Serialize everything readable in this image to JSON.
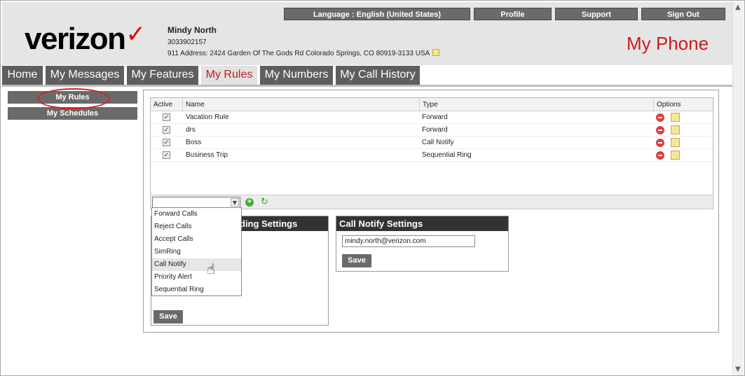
{
  "top_nav": {
    "language": "Language : English (United States)",
    "profile": "Profile",
    "support": "Support",
    "sign_out": "Sign Out"
  },
  "brand": {
    "logo_text": "verizon",
    "logo_mark": "✓",
    "page_heading": "My Phone"
  },
  "user": {
    "name": "Mindy North",
    "phone": "3033902157",
    "address": "911 Address: 2424 Garden Of The Gods Rd Colorado Springs, CO 80919-3133 USA"
  },
  "tabs": [
    {
      "label": "Home"
    },
    {
      "label": "My Messages"
    },
    {
      "label": "My Features"
    },
    {
      "label": "My Rules"
    },
    {
      "label": "My Numbers"
    },
    {
      "label": "My Call History"
    }
  ],
  "active_tab": "My Rules",
  "sidebar": {
    "items": [
      {
        "label": "My Rules"
      },
      {
        "label": "My Schedules"
      }
    ]
  },
  "rules_table": {
    "columns": [
      "Active",
      "Name",
      "Type",
      "Options"
    ],
    "rows": [
      {
        "active": true,
        "name": "Vacation Rule",
        "type": "Forward"
      },
      {
        "active": true,
        "name": "drs",
        "type": "Forward"
      },
      {
        "active": true,
        "name": "Boss",
        "type": "Call Notify"
      },
      {
        "active": true,
        "name": "Business Trip",
        "type": "Sequential Ring"
      }
    ]
  },
  "rule_type_select": {
    "value": "",
    "options": [
      "Forward Calls",
      "Reject Calls",
      "Accept Calls",
      "SimRing",
      "Call Notify",
      "Priority Alert",
      "Sequential Ring"
    ],
    "hovered": "Call Notify"
  },
  "forwarding_settings": {
    "title_visible": "ding Settings",
    "save_label": "Save"
  },
  "call_notify_settings": {
    "title": "Call Notify Settings",
    "email": "mindy.north@verizon.com",
    "save_label": "Save"
  },
  "icons": {
    "delete": "delete-icon",
    "edit": "edit-icon",
    "add": "add-icon",
    "refresh": "refresh-icon",
    "note": "note-icon",
    "cursor": "hand-cursor-icon"
  },
  "colors": {
    "brand_red": "#cf1a1a",
    "tab_bg": "#5e5e5e",
    "button_bg": "#6a6a6a",
    "panel_title_bg": "#333333"
  }
}
